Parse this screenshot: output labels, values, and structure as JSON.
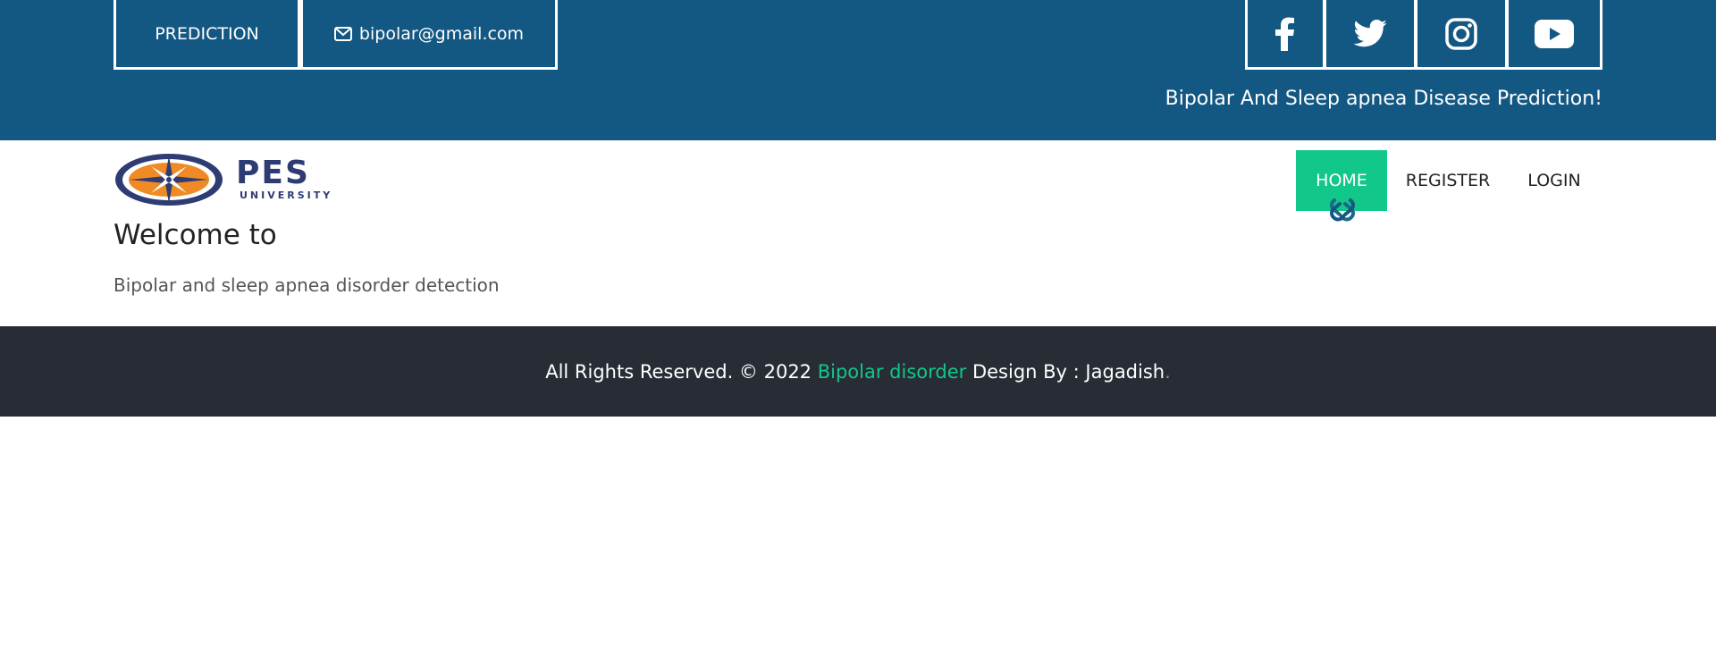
{
  "header": {
    "prediction_label": "PREDICTION",
    "email": "bipolar@gmail.com",
    "tagline": "Bipolar And Sleep apnea Disease Prediction!",
    "social": [
      "facebook-icon",
      "twitter-icon",
      "instagram-icon",
      "youtube-icon"
    ]
  },
  "logo": {
    "name": "PES",
    "sub": "UNIVERSITY"
  },
  "nav": {
    "home": "HOME",
    "register": "REGISTER",
    "login": "LOGIN"
  },
  "hero": {
    "title": "Welcome to",
    "subtitle": "Bipolar and sleep apnea disorder detection"
  },
  "footer": {
    "prefix": "All Rights Reserved. © 2022",
    "link": "Bipolar disorder",
    "middle": "Design By :",
    "author": "Jagadish",
    "end": "."
  },
  "colors": {
    "header_bg": "#135783",
    "accent": "#12c78a",
    "footer_bg": "#282d35"
  }
}
